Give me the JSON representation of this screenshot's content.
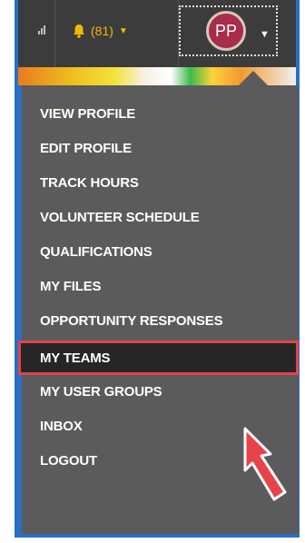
{
  "topbar": {
    "notifications_label": "(81)",
    "user_initials": "PP"
  },
  "icons": {
    "bell": "bell-icon",
    "caret": "chevron-down-icon"
  },
  "colors": {
    "topbar_bg": "#3c3c3c",
    "menu_bg": "#5b5b5b",
    "highlight_border": "#e0444a",
    "avatar_bg": "#a82c4c",
    "notification_color": "#f2b705"
  },
  "menu": {
    "items": [
      {
        "label": "VIEW PROFILE"
      },
      {
        "label": "EDIT PROFILE"
      },
      {
        "label": "TRACK HOURS"
      },
      {
        "label": "VOLUNTEER SCHEDULE"
      },
      {
        "label": "QUALIFICATIONS"
      },
      {
        "label": "MY FILES"
      },
      {
        "label": "OPPORTUNITY RESPONSES"
      },
      {
        "label": "MY TEAMS",
        "highlighted": true
      },
      {
        "label": "MY USER GROUPS"
      },
      {
        "label": "INBOX"
      },
      {
        "label": "LOGOUT"
      }
    ]
  }
}
